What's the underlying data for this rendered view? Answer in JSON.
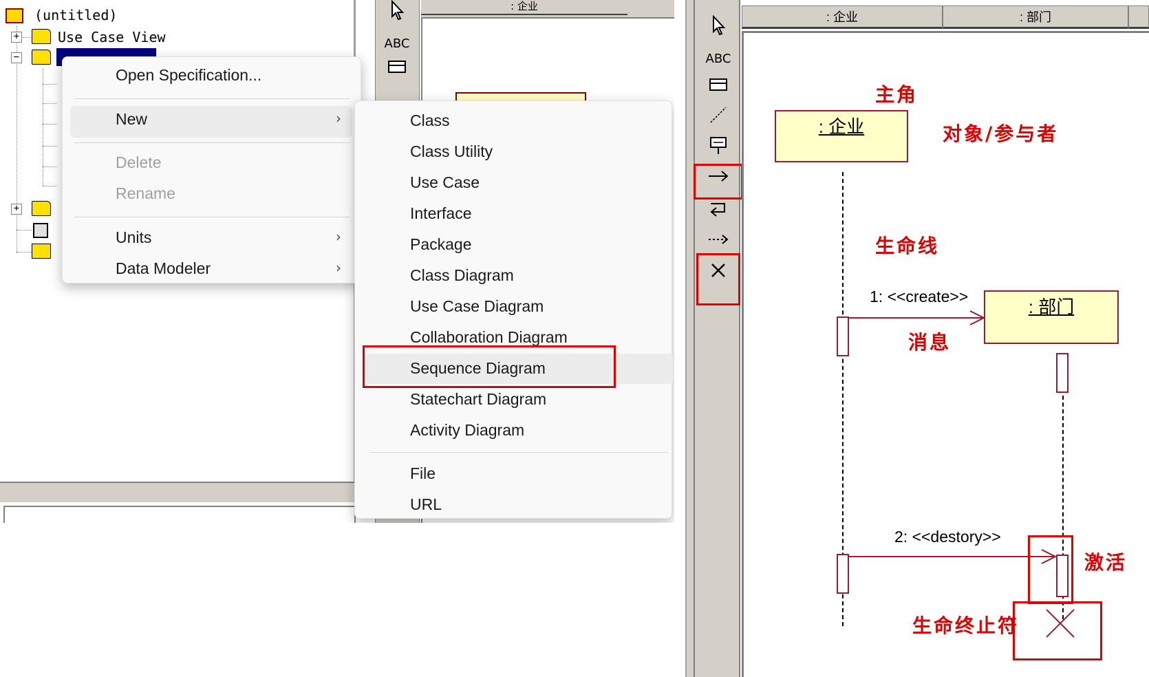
{
  "left": {
    "tree": {
      "root_label": "(untitled)",
      "use_case_view_label": "Use Case View",
      "plus_symbol": "+",
      "minus_symbol": "−"
    },
    "canvas_tab": ": 企业",
    "toolbar": {
      "select_icon": "arrow-pointer-icon",
      "text_label": "ABC",
      "note_icon": "note-icon"
    },
    "context_menu": {
      "items": [
        {
          "label": "Open Specification...",
          "enabled": true,
          "submenu": false
        },
        {
          "label": "New",
          "enabled": true,
          "submenu": true,
          "hovered": true
        },
        {
          "label": "Delete",
          "enabled": false,
          "submenu": false
        },
        {
          "label": "Rename",
          "enabled": false,
          "submenu": false
        },
        {
          "label": "Units",
          "enabled": true,
          "submenu": true
        },
        {
          "label": "Data Modeler",
          "enabled": true,
          "submenu": true
        }
      ],
      "arrow": "›"
    },
    "new_submenu": {
      "items": [
        "Class",
        "Class Utility",
        "Use Case",
        "Interface",
        "Package",
        "Class Diagram",
        "Use Case Diagram",
        "Collaboration Diagram",
        "Sequence Diagram",
        "Statechart Diagram",
        "Activity Diagram",
        "File",
        "URL"
      ],
      "highlighted": "Sequence Diagram"
    }
  },
  "right": {
    "toolbar": {
      "text_label": "ABC",
      "tools": [
        "selection-tool",
        "text-box-tool",
        "note-tool",
        "anchor-note-tool",
        "object-tool",
        "object-message-tool",
        "message-to-self-tool",
        "return-message-tool",
        "destruction-marker-tool"
      ]
    },
    "headers": [
      ": 企业",
      ": 部门"
    ],
    "objects": {
      "enterprise": ": 企业",
      "department": ": 部门"
    },
    "messages": [
      {
        "label": "1: <<create>>"
      },
      {
        "label": "2: <<destory>>"
      }
    ],
    "annotations": {
      "actor": "主角",
      "object_participant": "对象/参与者",
      "lifeline": "生命线",
      "message": "消息",
      "activation": "激活",
      "destruction": "生命终止符"
    },
    "colors": {
      "highlight": "#e00000",
      "object_fill": "#ffffc8",
      "object_border": "#9b1b30"
    }
  }
}
